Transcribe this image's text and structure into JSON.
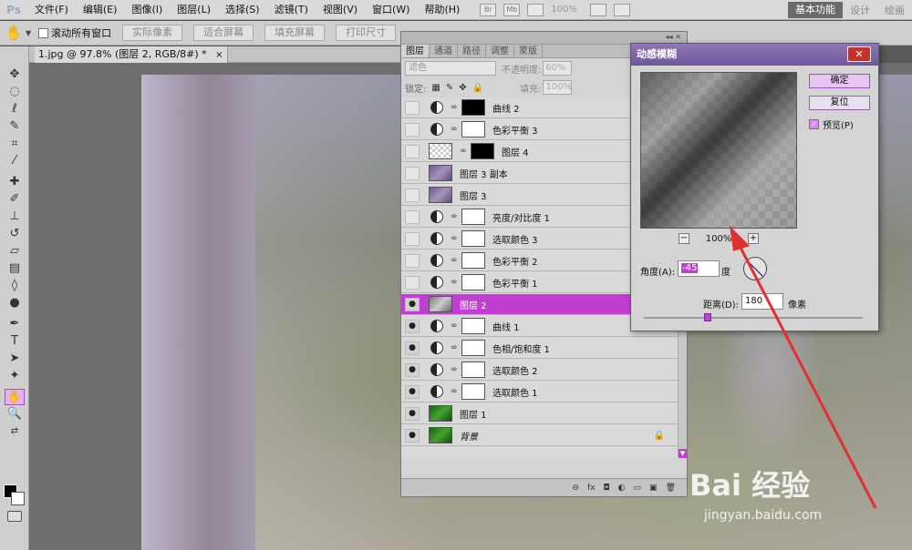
{
  "app": {
    "logo": "Ps"
  },
  "menu": [
    "文件(F)",
    "编辑(E)",
    "图像(I)",
    "图层(L)",
    "选择(S)",
    "滤镜(T)",
    "视图(V)",
    "窗口(W)",
    "帮助(H)"
  ],
  "menu_tools": {
    "br": "Br",
    "mb": "Mb",
    "zoom": "100%"
  },
  "workspace": {
    "active": "基本功能",
    "items": [
      "设计",
      "绘画"
    ]
  },
  "options_bar": {
    "scroll_all": "滚动所有窗口",
    "buttons": [
      "实际像素",
      "适合屏幕",
      "填充屏幕",
      "打印尺寸"
    ]
  },
  "document": {
    "tab": "1.jpg @ 97.8% (图层 2, RGB/8#) *",
    "close": "×"
  },
  "layers_panel": {
    "tabs": [
      "图层",
      "通道",
      "路径",
      "调整",
      "蒙版"
    ],
    "blend_mode": "滤色",
    "opacity_label": "不透明度:",
    "opacity": "60%",
    "lock_label": "锁定:",
    "fill_label": "填充:",
    "fill": "100%",
    "layers": [
      {
        "name": "曲线 2",
        "kind": "adj",
        "mask": "black",
        "visible": false
      },
      {
        "name": "色彩平衡 3",
        "kind": "adj",
        "mask": "white",
        "visible": false
      },
      {
        "name": "图层 4",
        "kind": "pixel-mask",
        "visible": false
      },
      {
        "name": "图层 3 副本",
        "kind": "pixel",
        "visible": false
      },
      {
        "name": "图层 3",
        "kind": "pixel",
        "visible": false
      },
      {
        "name": "亮度/对比度 1",
        "kind": "adj",
        "mask": "white",
        "visible": false
      },
      {
        "name": "选取颜色 3",
        "kind": "adj",
        "mask": "white",
        "visible": false
      },
      {
        "name": "色彩平衡 2",
        "kind": "adj",
        "mask": "white",
        "visible": false
      },
      {
        "name": "色彩平衡 1",
        "kind": "adj",
        "mask": "white",
        "visible": false
      },
      {
        "name": "图层 2",
        "kind": "pixel-gray",
        "visible": true,
        "selected": true
      },
      {
        "name": "曲线 1",
        "kind": "adj",
        "mask": "white",
        "visible": true
      },
      {
        "name": "色相/饱和度 1",
        "kind": "adj",
        "mask": "white",
        "visible": true
      },
      {
        "name": "选取颜色 2",
        "kind": "adj",
        "mask": "white",
        "visible": true
      },
      {
        "name": "选取颜色 1",
        "kind": "adj",
        "mask": "white",
        "visible": true
      },
      {
        "name": "图层 1",
        "kind": "pixel-green",
        "visible": true
      },
      {
        "name": "背景",
        "kind": "bg",
        "visible": true,
        "locked": true
      }
    ],
    "bottom_icons": [
      "link-icon",
      "fx-icon",
      "mask-icon",
      "adjustment-icon",
      "folder-icon",
      "new-layer-icon",
      "trash-icon"
    ],
    "bottom_glyphs": [
      "⊖",
      "fx",
      "◘",
      "◐",
      "▭",
      "▣",
      "🗑"
    ]
  },
  "dialog": {
    "title": "动感模糊",
    "close": "✕",
    "ok": "确定",
    "reset": "复位",
    "preview_label": "预览(P)",
    "preview_checked": true,
    "zoom_minus": "−",
    "zoom_plus": "+",
    "zoom": "100%",
    "angle_label": "角度(A):",
    "angle": "-45",
    "angle_unit": "度",
    "distance_label": "距离(D):",
    "distance": "180",
    "distance_unit": "像素"
  },
  "watermark": {
    "logo": "Bai 经验",
    "url": "jingyan.baidu.com"
  },
  "colors": {
    "accent": "#c03fd2",
    "dialog_title": "#7a5fa6",
    "arrow": "#e03030"
  }
}
